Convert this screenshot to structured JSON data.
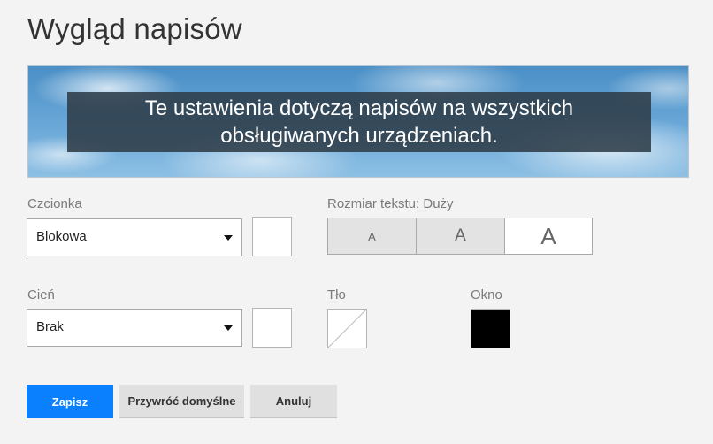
{
  "page": {
    "title": "Wygląd napisów"
  },
  "preview": {
    "caption_line1": "Te ustawienia dotyczą napisów na wszystkich",
    "caption_line2": "obsługiwanych urządzeniach."
  },
  "font": {
    "label": "Czcionka",
    "value": "Blokowa",
    "color_swatch": "#ffffff"
  },
  "text_size": {
    "label": "Rozmiar tekstu: Duży",
    "options": [
      "A",
      "A",
      "A"
    ],
    "selected": "large"
  },
  "shadow": {
    "label": "Cień",
    "value": "Brak",
    "color_swatch": "#ffffff"
  },
  "background": {
    "label": "Tło",
    "color": "none"
  },
  "window": {
    "label": "Okno",
    "color": "#000000"
  },
  "actions": {
    "save_label": "Zapisz",
    "restore_label": "Przywróć domyślne",
    "cancel_label": "Anuluj"
  },
  "colors": {
    "primary_button": "#0a80ff",
    "page_background": "#f3f3f3"
  }
}
